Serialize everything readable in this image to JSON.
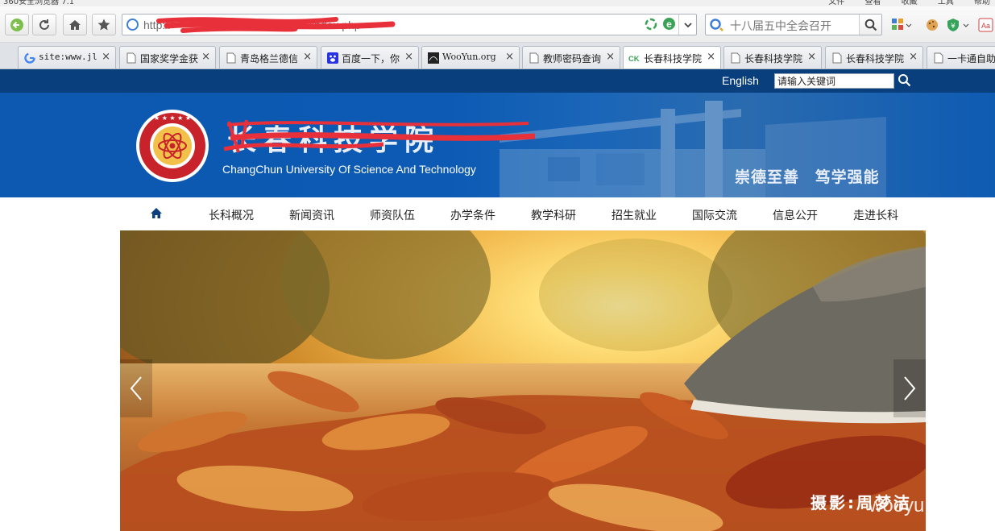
{
  "browser": {
    "top_strip": {
      "left_text": "360安全浏览器 7.1",
      "right_items": "文件 查看 收藏 工具 帮助"
    },
    "address_bar": {
      "url_visible": "http://",
      "url_suffix": "/index.php"
    },
    "search_bar": {
      "query": "十八届五中全会召开"
    },
    "tabs": [
      {
        "label": "site:www.jl",
        "icon": "google-icon"
      },
      {
        "label": "国家奖学金获",
        "icon": "page-icon"
      },
      {
        "label": "青岛格兰德信",
        "icon": "page-icon"
      },
      {
        "label": "百度一下，你",
        "icon": "baidu-icon"
      },
      {
        "label": "WooYun.org",
        "icon": "wooyun-icon"
      },
      {
        "label": "教师密码查询",
        "icon": "page-icon"
      },
      {
        "label": "长春科技学院",
        "icon": "ck-icon",
        "active": true
      },
      {
        "label": "长春科技学院",
        "icon": "page-icon"
      },
      {
        "label": "长春科技学院",
        "icon": "page-icon"
      },
      {
        "label": "一卡通自助",
        "icon": "page-icon"
      }
    ],
    "tab_close": "×"
  },
  "site": {
    "header": {
      "english_link": "English",
      "search_placeholder": "请输入关键词",
      "school_name_cn": "长春科技学院",
      "school_name_en": "ChangChun University Of Science And Technology",
      "motto": "崇德至善 笃学强能"
    },
    "nav": [
      "长科概况",
      "新闻资讯",
      "师资队伍",
      "办学条件",
      "教学科研",
      "招生就业",
      "国际交流",
      "信息公开",
      "走进长科"
    ],
    "slider": {
      "photo_credit": "摄影:周梦洁",
      "prev": "‹",
      "next": "›"
    },
    "watermark": "wooyun.org"
  },
  "colors": {
    "top_bar": "#083f7c",
    "banner": "#0c5ab4",
    "redaction": "#e8303a"
  }
}
